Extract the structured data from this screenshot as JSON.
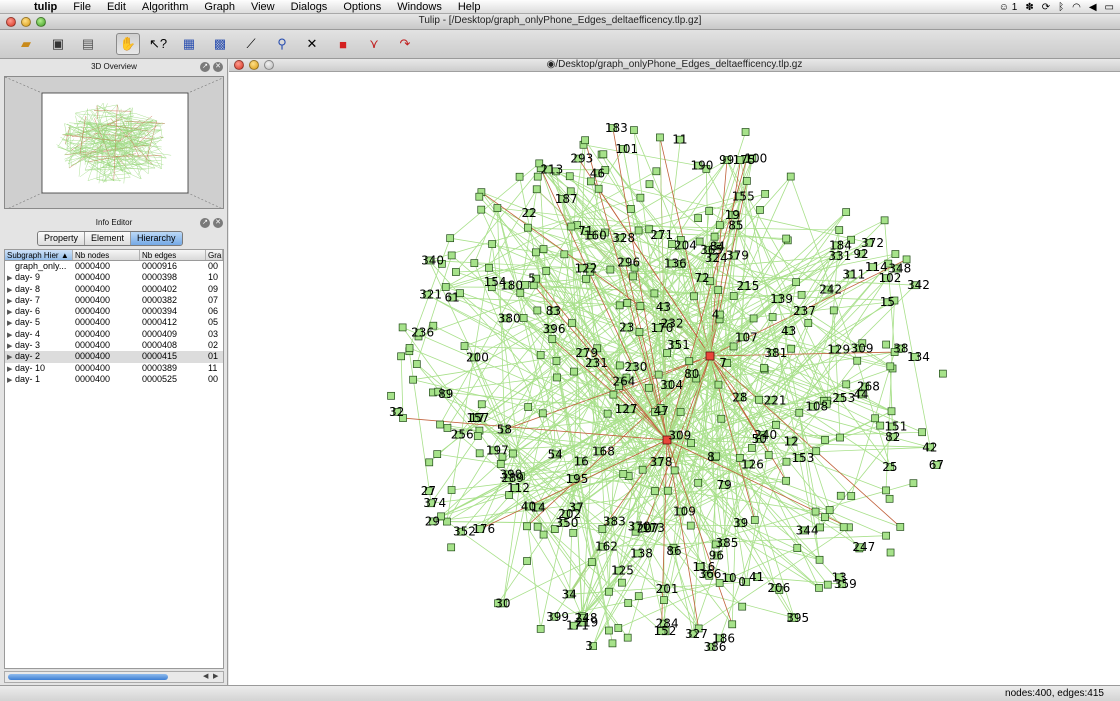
{
  "menubar": {
    "app_name": "tulip",
    "items": [
      "File",
      "Edit",
      "Algorithm",
      "Graph",
      "View",
      "Dialogs",
      "Options",
      "Windows",
      "Help"
    ],
    "status_text": "1"
  },
  "window": {
    "title": "Tulip - [/Desktop/graph_onlyPhone_Edges_deltaefficency.tlp.gz]"
  },
  "toolbar": {
    "tools": [
      "open-icon",
      "save-icon",
      "print-icon",
      "hand-icon",
      "pointer-question-icon",
      "select-rect-icon",
      "grid-select-icon",
      "magic-wand-icon",
      "zoom-icon",
      "delete-icon",
      "add-node-icon",
      "add-edge-icon",
      "edit-edge-icon"
    ]
  },
  "overview": {
    "title": "3D Overview"
  },
  "info_editor": {
    "title": "Info Editor",
    "tabs": [
      "Property",
      "Element",
      "Hierarchy"
    ],
    "active_tab": "Hierarchy",
    "columns": [
      "Subgraph Hier",
      "Nb nodes",
      "Nb edges",
      "Gra"
    ],
    "rows": [
      {
        "name": "graph_only...",
        "nodes": "0000400",
        "edges": "0000916",
        "g": "00",
        "arrow": ""
      },
      {
        "name": "day- 9",
        "nodes": "0000400",
        "edges": "0000398",
        "g": "10",
        "arrow": "▶"
      },
      {
        "name": "day- 8",
        "nodes": "0000400",
        "edges": "0000402",
        "g": "09",
        "arrow": "▶"
      },
      {
        "name": "day- 7",
        "nodes": "0000400",
        "edges": "0000382",
        "g": "07",
        "arrow": "▶"
      },
      {
        "name": "day- 6",
        "nodes": "0000400",
        "edges": "0000394",
        "g": "06",
        "arrow": "▶"
      },
      {
        "name": "day- 5",
        "nodes": "0000400",
        "edges": "0000412",
        "g": "05",
        "arrow": "▶"
      },
      {
        "name": "day- 4",
        "nodes": "0000400",
        "edges": "0000409",
        "g": "03",
        "arrow": "▶"
      },
      {
        "name": "day- 3",
        "nodes": "0000400",
        "edges": "0000408",
        "g": "02",
        "arrow": "▶"
      },
      {
        "name": "day- 2",
        "nodes": "0000400",
        "edges": "0000415",
        "g": "01",
        "arrow": "▶"
      },
      {
        "name": "day- 10",
        "nodes": "0000400",
        "edges": "0000389",
        "g": "11",
        "arrow": "▶"
      },
      {
        "name": "day- 1",
        "nodes": "0000400",
        "edges": "0000525",
        "g": "00",
        "arrow": "▶"
      }
    ],
    "highlighted_row": 8
  },
  "graph_view": {
    "title": "/Desktop/graph_onlyPhone_Edges_deltaefficency.tlp.gz",
    "colors": {
      "edge": "#a8e08a",
      "hub_edge": "#c0603a",
      "node_fill": "#a6e28a",
      "hub_fill": "#e8463a"
    },
    "labels": [
      "122",
      "396",
      "289",
      "379",
      "29",
      "236",
      "311",
      "213",
      "112",
      "22",
      "350",
      "359",
      "366",
      "219",
      "58",
      "139",
      "183",
      "151",
      "399",
      "157",
      "85",
      "109",
      "370",
      "101",
      "126",
      "170",
      "207",
      "221",
      "390",
      "30",
      "11",
      "40",
      "378",
      "96",
      "127",
      "168",
      "240",
      "237",
      "100",
      "186",
      "385",
      "15",
      "206",
      "37",
      "92",
      "232",
      "293",
      "43",
      "365",
      "38",
      "44",
      "176",
      "383",
      "153",
      "256",
      "187",
      "28",
      "247",
      "72",
      "348",
      "27",
      "14",
      "19",
      "10",
      "0",
      "327",
      "201",
      "34",
      "17",
      "328",
      "284",
      "344",
      "5",
      "3",
      "114",
      "324",
      "86",
      "279",
      "175",
      "46",
      "134",
      "82",
      "195",
      "23",
      "160",
      "162",
      "102",
      "321",
      "309",
      "13",
      "116",
      "83",
      "253",
      "202",
      "248",
      "41",
      "331",
      "79",
      "173",
      "372",
      "184",
      "374",
      "152",
      "7",
      "4",
      "50",
      "309",
      "80",
      "16",
      "180",
      "42",
      "107",
      "61",
      "304",
      "39",
      "271",
      "138",
      "136",
      "296",
      "54",
      "32",
      "268",
      "171",
      "47",
      "71",
      "84",
      "190",
      "340",
      "351",
      "342",
      "395",
      "231",
      "386",
      "8",
      "89",
      "67",
      "200",
      "155",
      "242",
      "99",
      "154",
      "25",
      "108",
      "12",
      "264",
      "352",
      "125",
      "129",
      "43",
      "381",
      "230",
      "197",
      "215",
      "380",
      "204"
    ]
  },
  "statusbar": {
    "text": "nodes:400, edges:415"
  }
}
